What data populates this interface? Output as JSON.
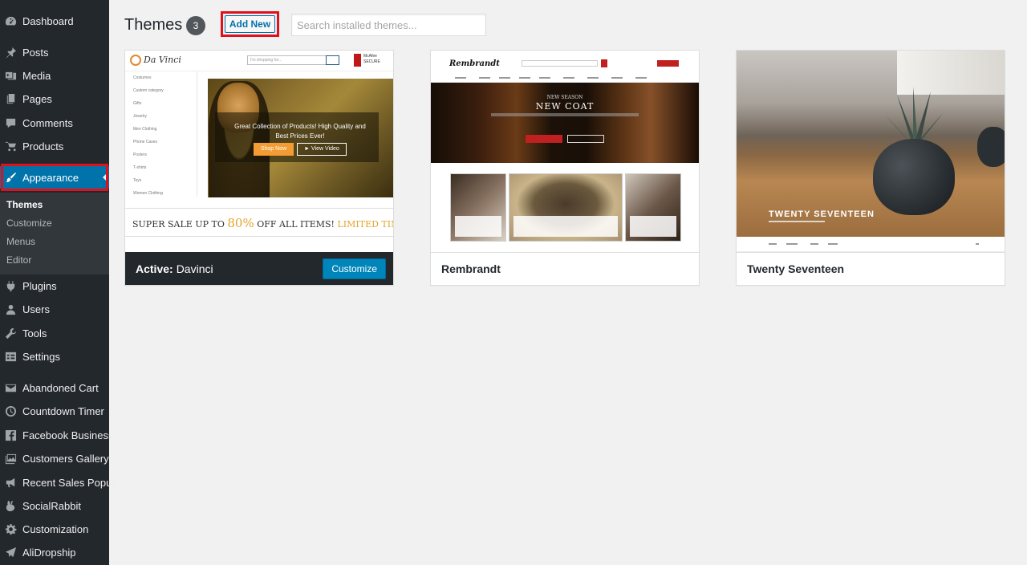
{
  "sidebar": {
    "items": [
      {
        "label": "Dashboard",
        "icon": "dashboard-icon"
      },
      {
        "label": "Posts",
        "icon": "pin-icon"
      },
      {
        "label": "Media",
        "icon": "media-icon"
      },
      {
        "label": "Pages",
        "icon": "pages-icon"
      },
      {
        "label": "Comments",
        "icon": "comment-icon"
      },
      {
        "label": "Products",
        "icon": "cart-icon"
      },
      {
        "label": "Appearance",
        "icon": "brush-icon",
        "active": true
      },
      {
        "label": "Plugins",
        "icon": "plugin-icon"
      },
      {
        "label": "Users",
        "icon": "user-icon"
      },
      {
        "label": "Tools",
        "icon": "wrench-icon"
      },
      {
        "label": "Settings",
        "icon": "settings-icon"
      },
      {
        "label": "Abandoned Cart",
        "icon": "envelope-icon"
      },
      {
        "label": "Countdown Timer",
        "icon": "clock-icon"
      },
      {
        "label": "Facebook Business",
        "icon": "facebook-icon"
      },
      {
        "label": "Customers Gallery",
        "icon": "gallery-icon"
      },
      {
        "label": "Recent Sales Popup",
        "icon": "megaphone-icon"
      },
      {
        "label": "SocialRabbit",
        "icon": "rabbit-icon"
      },
      {
        "label": "Customization",
        "icon": "gear-icon"
      },
      {
        "label": "AliDropship",
        "icon": "plane-icon"
      }
    ],
    "submenu": [
      "Themes",
      "Customize",
      "Menus",
      "Editor"
    ]
  },
  "header": {
    "title": "Themes",
    "count": "3",
    "add_new_label": "Add New",
    "search_placeholder": "Search installed themes..."
  },
  "themes": [
    {
      "name": "Davinci",
      "active": true,
      "active_prefix": "Active:",
      "customize_label": "Customize",
      "preview": {
        "logo": "Da Vinci",
        "search_placeholder": "I'm shopping for...",
        "badge": "McAfee SECURE",
        "categories": [
          "Costumes",
          "Custom category",
          "Gifts",
          "Jewelry",
          "Men Clothing",
          "Phone Cases",
          "Posters",
          "T-shirts",
          "Toys",
          "Women Clothing"
        ],
        "banner_text": "Great Collection of Products! High Quality and Best Prices Ever!",
        "shop_now": "Shop Now",
        "view_video": "► View Video",
        "sale_prefix": "SUPER SALE UP TO",
        "sale_percent": "80%",
        "sale_suffix": "OFF ALL ITEMS!",
        "sale_limited": "LIMITED TIME OF"
      }
    },
    {
      "name": "Rembrandt",
      "active": false,
      "preview": {
        "logo": "Rembrandt",
        "hero_kicker": "NEW SEASON",
        "hero_title": "NEW COAT"
      }
    },
    {
      "name": "Twenty Seventeen",
      "active": false,
      "preview": {
        "hero_title": "TWENTY SEVENTEEN"
      }
    }
  ],
  "colors": {
    "sidebar_bg": "#23282d",
    "submenu_bg": "#32373c",
    "accent": "#0073aa",
    "highlight_red": "#e2101a",
    "button_primary": "#0085ba"
  }
}
